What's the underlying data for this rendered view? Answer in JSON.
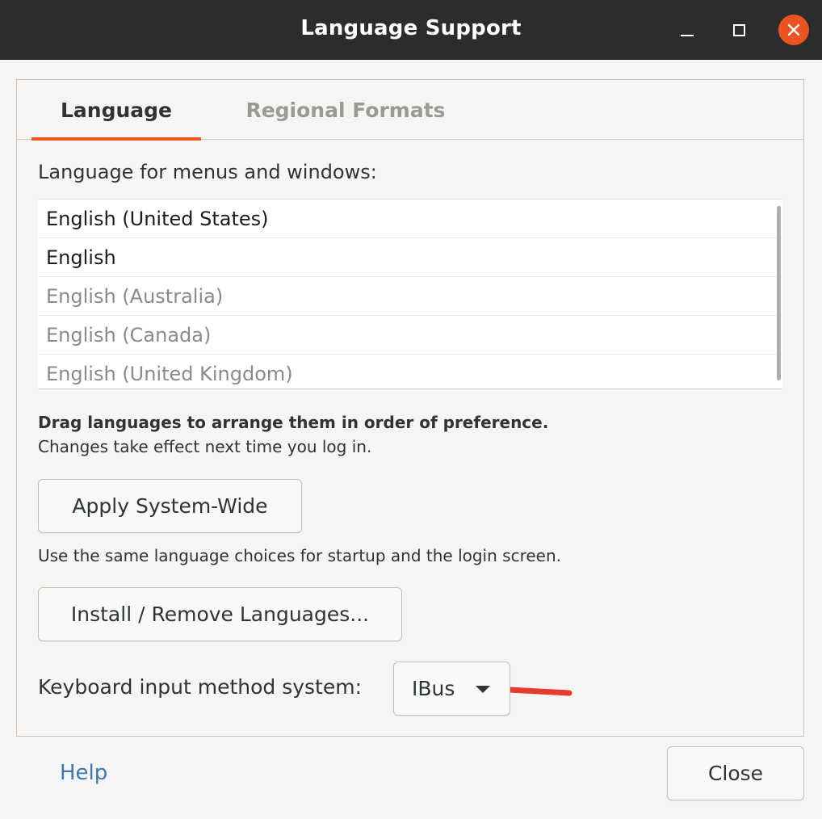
{
  "window": {
    "title": "Language Support"
  },
  "tabs": [
    {
      "label": "Language",
      "active": true
    },
    {
      "label": "Regional Formats",
      "active": false
    }
  ],
  "language_section": {
    "label": "Language for menus and windows:",
    "languages": [
      {
        "name": "English (United States)",
        "active": true
      },
      {
        "name": "English",
        "active": true
      },
      {
        "name": "English (Australia)",
        "active": false
      },
      {
        "name": "English (Canada)",
        "active": false
      },
      {
        "name": "English (United Kingdom)",
        "active": false
      }
    ],
    "drag_hint": "Drag languages to arrange them in order of preference.",
    "effect_hint": "Changes take effect next time you log in."
  },
  "buttons": {
    "apply_system_wide": "Apply System-Wide",
    "apply_description": "Use the same language choices for startup and the login screen.",
    "install_remove": "Install / Remove Languages...",
    "close": "Close"
  },
  "keyboard": {
    "label": "Keyboard input method system:",
    "selected": "IBus"
  },
  "help_link": "Help",
  "colors": {
    "accent": "#e95420",
    "annotation_arrow": "#e63b2e",
    "titlebar": "#2c2c2c",
    "link": "#3d78b6"
  },
  "icons": {
    "minimize": "minimize-icon",
    "maximize": "maximize-icon",
    "close": "close-icon",
    "dropdown": "caret-down-icon",
    "annotation": "red-arrow-annotation"
  }
}
